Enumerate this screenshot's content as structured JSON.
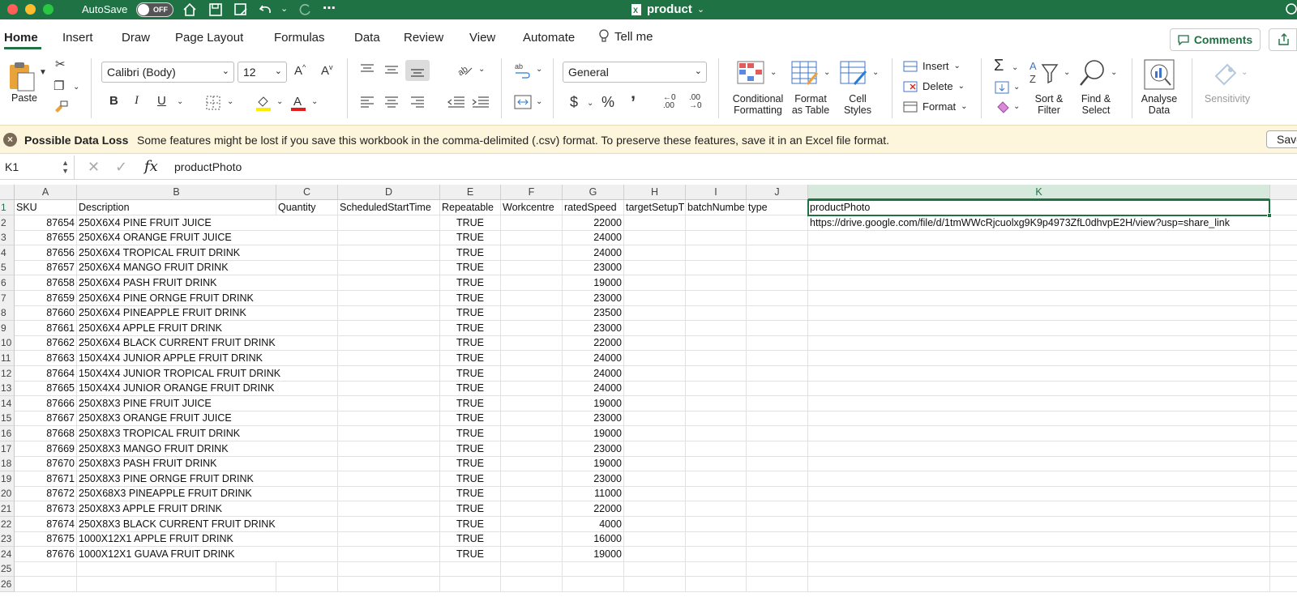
{
  "titlebar": {
    "autosave_label": "AutoSave",
    "autosave_state": "OFF",
    "document_title": "product"
  },
  "tabs": [
    "Home",
    "Insert",
    "Draw",
    "Page Layout",
    "Formulas",
    "Data",
    "Review",
    "View",
    "Automate"
  ],
  "tell_me": "Tell me",
  "comments_label": "Comments",
  "ribbon": {
    "paste": "Paste",
    "font_name": "Calibri (Body)",
    "font_size": "12",
    "number_format": "General",
    "conditional_formatting": [
      "Conditional",
      "Formatting"
    ],
    "format_as_table": [
      "Format",
      "as Table"
    ],
    "cell_styles": [
      "Cell",
      "Styles"
    ],
    "insert": "Insert",
    "delete": "Delete",
    "format": "Format",
    "sort_filter": [
      "Sort &",
      "Filter"
    ],
    "find_select": [
      "Find &",
      "Select"
    ],
    "analyse_data": [
      "Analyse",
      "Data"
    ],
    "sensitivity": "Sensitivity"
  },
  "message_bar": {
    "title": "Possible Data Loss",
    "text": "Some features might be lost if you save this workbook in the comma-delimited (.csv) format. To preserve these features, save it in an Excel file format.",
    "button": "Save"
  },
  "formula_bar": {
    "name_box": "K1",
    "content": "productPhoto"
  },
  "sheet": {
    "columns": [
      "A",
      "B",
      "C",
      "D",
      "E",
      "F",
      "G",
      "H",
      "I",
      "J",
      "K"
    ],
    "headers": [
      "SKU",
      "Description",
      "Quantity",
      "ScheduledStartTime",
      "Repeatable",
      "Workcentre",
      "ratedSpeed",
      "targetSetupT",
      "batchNumbe",
      "type",
      "productPhoto"
    ],
    "photo_link": "https://drive.google.com/file/d/1tmWWcRjcuolxg9K9p4973ZfL0dhvpE2H/view?usp=share_link",
    "rows": [
      {
        "sku": "87654",
        "desc": "250X6X4 PINE FRUIT JUICE",
        "rep": "TRUE",
        "speed": "22000"
      },
      {
        "sku": "87655",
        "desc": "250X6X4 ORANGE FRUIT JUICE",
        "rep": "TRUE",
        "speed": "24000"
      },
      {
        "sku": "87656",
        "desc": "250X6X4 TROPICAL FRUIT DRINK",
        "rep": "TRUE",
        "speed": "24000"
      },
      {
        "sku": "87657",
        "desc": "250X6X4 MANGO FRUIT DRINK",
        "rep": "TRUE",
        "speed": "23000"
      },
      {
        "sku": "87658",
        "desc": "250X6X4 PASH FRUIT DRINK",
        "rep": "TRUE",
        "speed": "19000"
      },
      {
        "sku": "87659",
        "desc": "250X6X4 PINE ORNGE FRUIT DRINK",
        "rep": "TRUE",
        "speed": "23000"
      },
      {
        "sku": "87660",
        "desc": "250X6X4 PINEAPPLE FRUIT DRINK",
        "rep": "TRUE",
        "speed": "23500"
      },
      {
        "sku": "87661",
        "desc": "250X6X4 APPLE FRUIT DRINK",
        "rep": "TRUE",
        "speed": "23000"
      },
      {
        "sku": "87662",
        "desc": "250X6X4 BLACK CURRENT FRUIT DRINK",
        "rep": "TRUE",
        "speed": "22000"
      },
      {
        "sku": "87663",
        "desc": "150X4X4 JUNIOR APPLE FRUIT DRINK",
        "rep": "TRUE",
        "speed": "24000"
      },
      {
        "sku": "87664",
        "desc": "150X4X4 JUNIOR TROPICAL FRUIT DRINK",
        "rep": "TRUE",
        "speed": "24000"
      },
      {
        "sku": "87665",
        "desc": "150X4X4 JUNIOR ORANGE FRUIT DRINK",
        "rep": "TRUE",
        "speed": "24000"
      },
      {
        "sku": "87666",
        "desc": "250X8X3 PINE FRUIT JUICE",
        "rep": "TRUE",
        "speed": "19000"
      },
      {
        "sku": "87667",
        "desc": "250X8X3 ORANGE FRUIT JUICE",
        "rep": "TRUE",
        "speed": "23000"
      },
      {
        "sku": "87668",
        "desc": "250X8X3 TROPICAL FRUIT DRINK",
        "rep": "TRUE",
        "speed": "19000"
      },
      {
        "sku": "87669",
        "desc": "250X8X3 MANGO FRUIT DRINK",
        "rep": "TRUE",
        "speed": "23000"
      },
      {
        "sku": "87670",
        "desc": "250X8X3 PASH FRUIT DRINK",
        "rep": "TRUE",
        "speed": "19000"
      },
      {
        "sku": "87671",
        "desc": "250X8X3 PINE ORNGE FRUIT DRINK",
        "rep": "TRUE",
        "speed": "23000"
      },
      {
        "sku": "87672",
        "desc": "250X68X3 PINEAPPLE FRUIT DRINK",
        "rep": "TRUE",
        "speed": "11000"
      },
      {
        "sku": "87673",
        "desc": "250X8X3 APPLE FRUIT DRINK",
        "rep": "TRUE",
        "speed": "22000"
      },
      {
        "sku": "87674",
        "desc": "250X8X3 BLACK CURRENT FRUIT DRINK",
        "rep": "TRUE",
        "speed": "4000"
      },
      {
        "sku": "87675",
        "desc": "1000X12X1 APPLE FRUIT DRINK",
        "rep": "TRUE",
        "speed": "16000"
      },
      {
        "sku": "87676",
        "desc": "1000X12X1 GUAVA FRUIT DRINK",
        "rep": "TRUE",
        "speed": "19000"
      }
    ],
    "row_numbers": [
      "1",
      "2",
      "3",
      "4",
      "5",
      "6",
      "7",
      "8",
      "9",
      "10",
      "11",
      "12",
      "13",
      "14",
      "15",
      "16",
      "17",
      "18",
      "19",
      "20",
      "21",
      "22",
      "23",
      "24",
      "25",
      "26"
    ]
  },
  "colors": {
    "excel_green": "#1f7244",
    "message_bg": "#fdf6dd"
  }
}
